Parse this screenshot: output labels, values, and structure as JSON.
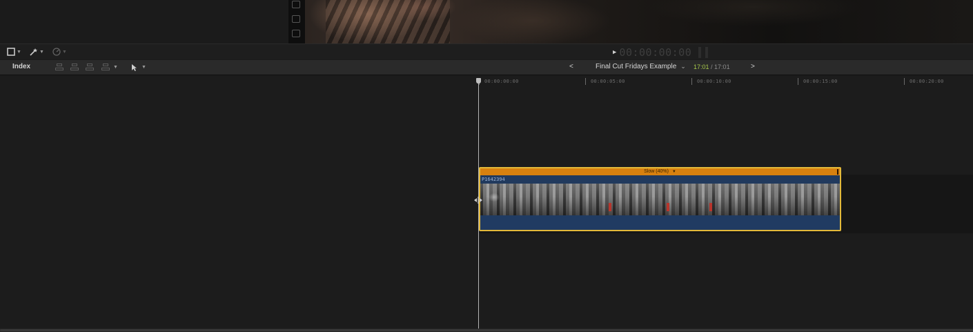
{
  "toolbar1": {
    "tools": [
      "clip-appearance",
      "effects-browser",
      "retime"
    ],
    "timecode": "00:00:00:00",
    "play_glyph": "▶"
  },
  "toolbar2": {
    "index_label": "Index",
    "nav_back": "<",
    "nav_forward": ">",
    "sequence_title": "Final Cut Fridays Example",
    "time_current": "17:01",
    "time_separator": " / ",
    "time_total": "17:01",
    "chevron": "⌄"
  },
  "ruler": {
    "labels": [
      "00:00:00:00",
      "00:00:05:00",
      "00:00:10:00",
      "00:00:15:00",
      "00:00:20:00"
    ]
  },
  "clip": {
    "retime_label": "Slow (40%)",
    "name": "P1642394",
    "border_color": "#e3b93a",
    "retime_color": "#d8810f",
    "body_color": "#213a5e"
  },
  "colors": {
    "timecode_active": "#a7c84a"
  }
}
